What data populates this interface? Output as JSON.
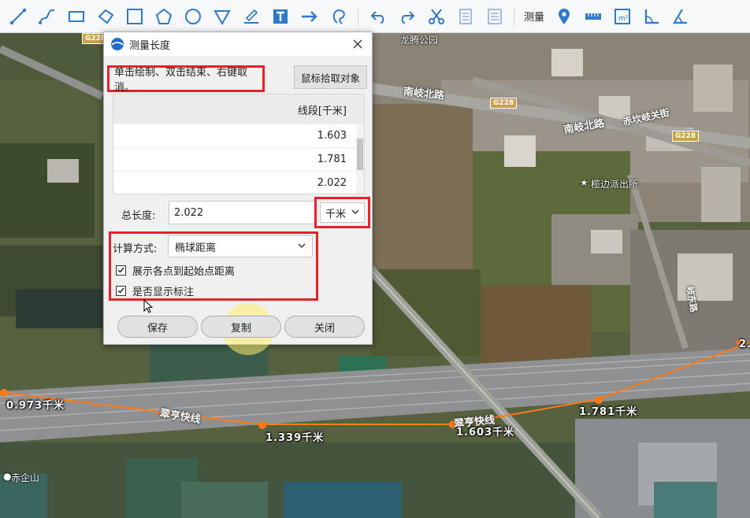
{
  "toolbar": {
    "tools": [
      {
        "name": "draw-line-icon"
      },
      {
        "name": "draw-curve-icon"
      },
      {
        "name": "draw-rectangle-icon"
      },
      {
        "name": "draw-freeform-polygon-icon"
      },
      {
        "name": "draw-square-icon"
      },
      {
        "name": "draw-pentagon-icon"
      },
      {
        "name": "draw-circle-icon"
      },
      {
        "name": "draw-triangle-icon"
      },
      {
        "name": "draw-water-level-icon"
      },
      {
        "name": "draw-text-icon"
      },
      {
        "name": "draw-arrow-icon"
      },
      {
        "name": "draw-lasso-icon"
      }
    ],
    "edit_tools": [
      {
        "name": "undo-icon"
      },
      {
        "name": "redo-icon"
      },
      {
        "name": "cut-icon"
      },
      {
        "name": "copy-doc-icon"
      },
      {
        "name": "paste-doc-icon"
      }
    ],
    "measure_label": "测量",
    "measure_tools": [
      {
        "name": "measure-point-icon"
      },
      {
        "name": "measure-length-icon"
      },
      {
        "name": "measure-area-icon"
      },
      {
        "name": "measure-angle-icon"
      },
      {
        "name": "measure-height-icon"
      }
    ],
    "accent_color": "#2f79c9"
  },
  "map": {
    "places": {
      "park": "龙腾公园",
      "police": "榄边派出所",
      "village": "赤企山"
    },
    "roads": {
      "nanqi1": "南岐北路",
      "nanqi2": "南岐北路",
      "chikan": "赤坎岐关街",
      "expressway": "翠亨快线",
      "expressway2": "翠亨快线",
      "side": "岐东路"
    },
    "highway_badges": [
      "G228",
      "G228",
      "G228"
    ],
    "measure_labels": {
      "seg1": "0.973千米",
      "seg2": "1.339千米",
      "seg3": "1.603千米",
      "seg4": "1.781千米",
      "seg5": "2."
    },
    "measure_line_color": "#ff7a1a"
  },
  "dialog": {
    "title": "测量长度",
    "hint": "单击绘制、双击结束、右键取消。",
    "pick_button": "鼠标拾取对象",
    "table_header": "线段[千米]",
    "rows": [
      "1.603",
      "1.781",
      "2.022"
    ],
    "total_label": "总长度:",
    "total_value": "2.022",
    "unit": "千米",
    "calc_label": "计算方式:",
    "calc_method": "椭球距离",
    "check_show_distance": "展示各点到起始点距离",
    "check_show_label": "是否显示标注",
    "save": "保存",
    "copy": "复制",
    "close": "关闭",
    "highlight_color": "#e8202a"
  }
}
